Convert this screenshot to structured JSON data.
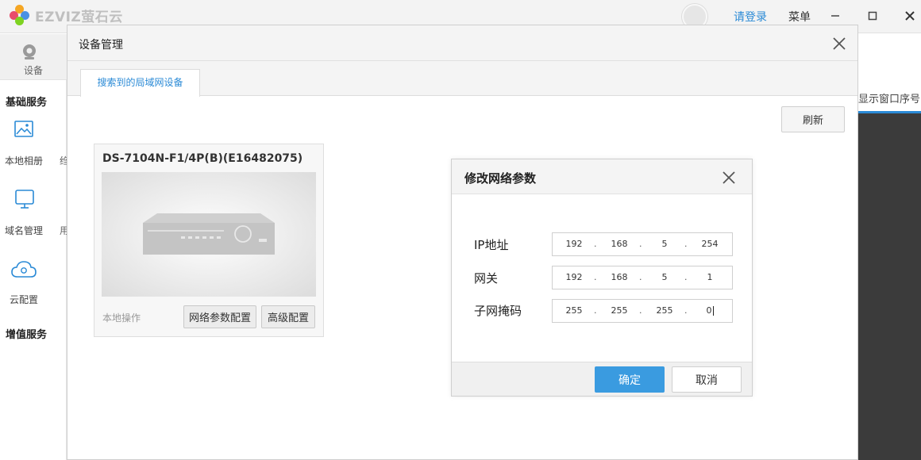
{
  "app": {
    "logo_text": "EZVIZ萤石云",
    "login_link": "请登录",
    "menu_label": "菜单",
    "window_icons": [
      "minimize-icon",
      "maximize-icon",
      "close-icon"
    ]
  },
  "sidebar": {
    "device_label": "设备",
    "section_basic": "基础服务",
    "items": [
      {
        "label": "本地相册",
        "icon": "image-icon",
        "clipped_label": "绉"
      },
      {
        "label": "域名管理",
        "icon": "monitor-icon",
        "clipped_label": "用"
      },
      {
        "label": "云配置",
        "icon": "cloud-gear-icon"
      }
    ],
    "section_value": "增值服务"
  },
  "right_panel": {
    "clipped_label": "显示窗口序号"
  },
  "device_manager": {
    "title": "设备管理",
    "tab_label": "搜索到的局域网设备",
    "refresh_label": "刷新",
    "device_card": {
      "title": "DS-7104N-F1/4P(B)(E16482075)",
      "local_ops_label": "本地操作",
      "net_config_label": "网络参数配置",
      "advanced_config_label": "高级配置"
    }
  },
  "network_dialog": {
    "title": "修改网络参数",
    "fields": [
      {
        "label": "IP地址",
        "octets": [
          "192",
          "168",
          "5",
          "254"
        ]
      },
      {
        "label": "网关",
        "octets": [
          "192",
          "168",
          "5",
          "1"
        ]
      },
      {
        "label": "子网掩码",
        "octets": [
          "255",
          "255",
          "255",
          "0"
        ]
      }
    ],
    "ok_label": "确定",
    "cancel_label": "取消"
  },
  "colors": {
    "accent": "#2a8ad6",
    "ok_button": "#3a9be0",
    "dark_panel": "#3b3b3b"
  }
}
